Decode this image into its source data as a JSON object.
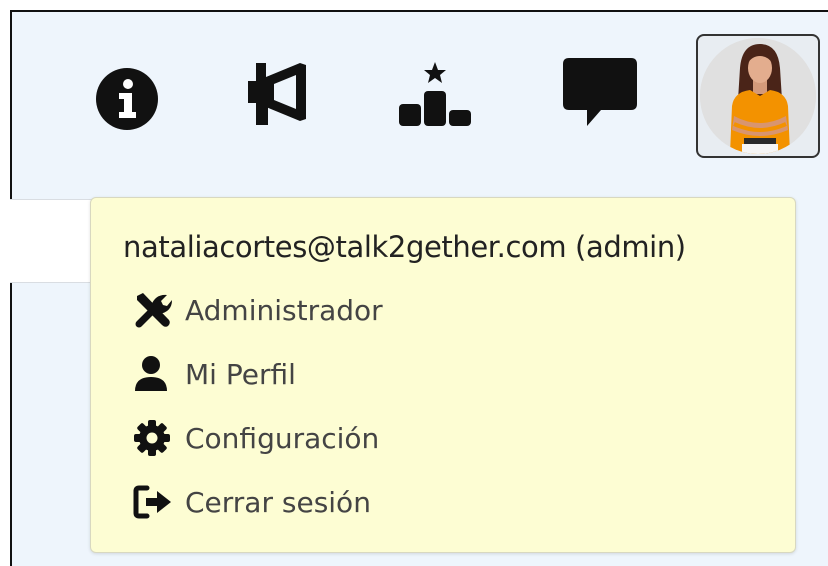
{
  "toolbar": {
    "icons": [
      {
        "name": "info-icon"
      },
      {
        "name": "megaphone-icon"
      },
      {
        "name": "ranking-podium-icon"
      },
      {
        "name": "chat-icon"
      }
    ],
    "avatar": {
      "name": "user-avatar"
    }
  },
  "user_menu": {
    "email": "nataliacortes@talk2gether.com (admin)",
    "items": [
      {
        "icon": "tools-icon",
        "label": "Administrador"
      },
      {
        "icon": "user-icon",
        "label": "Mi Perfil"
      },
      {
        "icon": "gear-icon",
        "label": "Configuración"
      },
      {
        "icon": "sign-out-icon",
        "label": "Cerrar sesión"
      }
    ]
  },
  "colors": {
    "page_background": "#eef5fc",
    "menu_background": "#fdfdd3",
    "icon_color": "#111111",
    "avatar_shirt": "#f39200"
  }
}
